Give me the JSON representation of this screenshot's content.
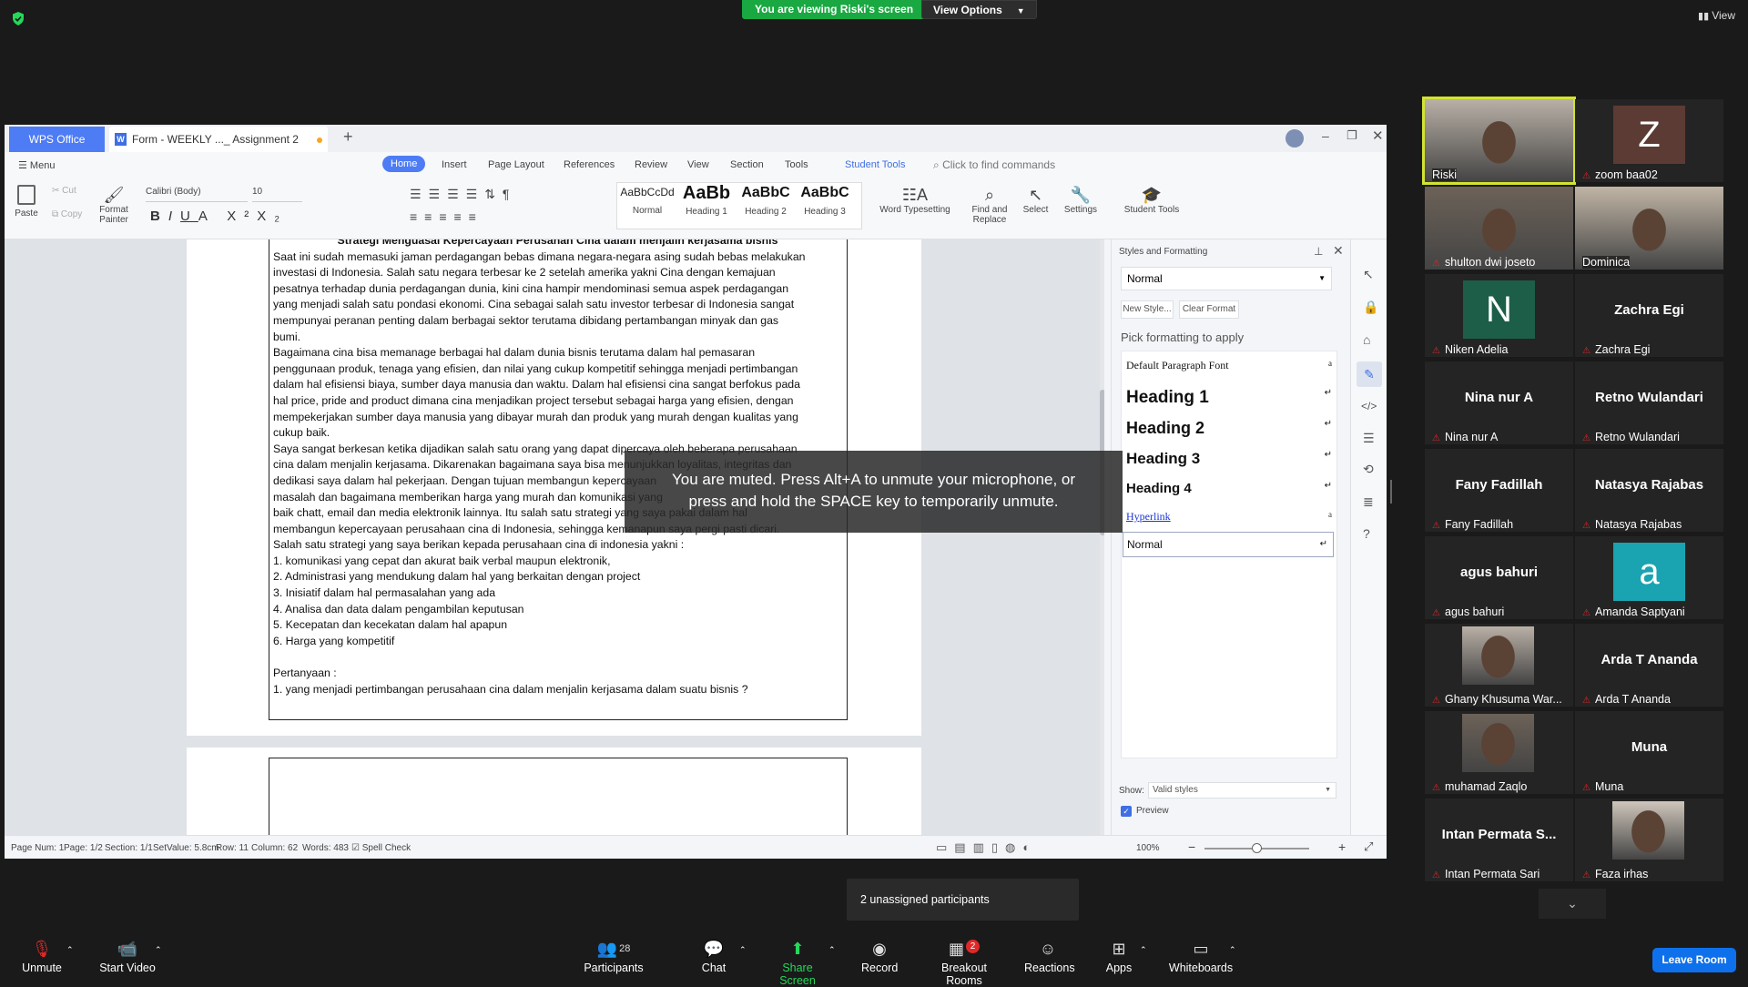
{
  "top": {
    "banner": "You are viewing Riski's screen",
    "view_options": "View Options",
    "view": "View"
  },
  "wps": {
    "app_tab": "WPS Office",
    "doc_tab": "Form - WEEKLY ..._ Assignment 2",
    "ribbon_tabs": [
      "Menu",
      "Home",
      "Insert",
      "Page Layout",
      "References",
      "Review",
      "View",
      "Section",
      "Tools",
      "Student Tools"
    ],
    "search_placeholder": "Click to find commands",
    "ribbon": {
      "paste": "Paste",
      "cut": "Cut",
      "copy": "Copy",
      "format_painter": "Format Painter",
      "font": "Calibri (Body)",
      "size": "10",
      "style_normal": "Normal",
      "style_h1": "Heading 1",
      "style_h2": "Heading 2",
      "style_h3": "Heading 3",
      "style_normal_sample": "AaBbCcDd",
      "style_h1_sample": "AaBb",
      "style_h2_sample": "AaBbC",
      "style_h3_sample": "AaBbC",
      "word_typesetting": "Word Typesetting",
      "find_replace": "Find and Replace",
      "select": "Select",
      "settings": "Settings",
      "student_tools": "Student Tools"
    },
    "doc_lines": [
      "Strategi Menguasai Kepercayaan Perusahan Cina dalam menjalin kerjasama bisnis",
      "Saat ini sudah memasuki jaman perdagangan bebas dimana negara-negara asing sudah bebas melakukan",
      "investasi di Indonesia. Salah satu negara terbesar ke 2 setelah amerika yakni Cina dengan kemajuan",
      "pesatnya terhadap dunia perdagangan dunia, kini cina hampir mendominasi semua aspek perdagangan",
      "yang menjadi salah satu pondasi ekonomi. Cina sebagai salah satu investor terbesar di Indonesia sangat",
      "mempunyai peranan penting dalam berbagai sektor terutama dibidang pertambangan minyak dan gas",
      "bumi.",
      "Bagaimana cina bisa memanage berbagai hal dalam dunia bisnis terutama dalam hal pemasaran",
      "penggunaan produk, tenaga yang efisien, dan nilai yang cukup kompetitif sehingga menjadi pertimbangan",
      "dalam hal efisiensi biaya, sumber daya manusia dan waktu. Dalam hal efisiensi cina sangat berfokus pada",
      "hal price, pride and  product dimana cina menjadikan project tersebut sebagai harga yang efisien, dengan",
      "mempekerjakan sumber daya manusia yang dibayar murah dan produk yang murah dengan kualitas yang",
      "cukup baik.",
      "Saya sangat berkesan ketika dijadikan salah satu orang yang dapat dipercaya oleh beberapa perusahaan",
      "cina dalam menjalin kerjasama. Dikarenakan bagaimana saya bisa menunjukkan loyalitas, integritas dan",
      "dedikasi saya dalam hal pekerjaan. Dengan tujuan membangun kepercayaan",
      "masalah dan bagaimana memberikan harga yang murah dan komunikasi yang",
      "baik chatt, email dan media elektronik lainnya. Itu salah satu strategi yang saya pakai dalam hal",
      "membangun kepercayaan perusahaan cina di Indonesia, sehingga kemanapun saya pergi pasti dicari.",
      "Salah satu strategi yang saya berikan kepada perusahaan cina di indonesia yakni :",
      "1. komunikasi yang cepat dan akurat baik verbal maupun elektronik,",
      "2. Administrasi yang mendukung dalam hal yang berkaitan dengan project",
      "3. Inisiatif dalam hal permasalahan yang ada",
      "4. Analisa dan data dalam pengambilan keputusan",
      "5. Kecepatan dan kecekatan dalam hal apapun",
      "6. Harga yang kompetitif",
      "",
      "Pertanyaan :",
      "1.  yang menjadi pertimbangan perusahaan cina dalam menjalin kerjasama dalam suatu bisnis ?"
    ],
    "styles_pane": {
      "title": "Styles and Formatting",
      "current": "Normal",
      "new_style": "New Style...",
      "clear_format": "Clear Format",
      "pick": "Pick formatting to apply",
      "items": [
        "Default Paragraph Font",
        "Heading 1",
        "Heading 2",
        "Heading 3",
        "Heading 4",
        "Hyperlink",
        "Normal"
      ],
      "show_label": "Show:",
      "show_value": "Valid styles",
      "preview": "Preview"
    },
    "status": {
      "page_num": "Page Num: 1",
      "page": "Page: 1/2",
      "section": "Section: 1/1",
      "setvalue": "SetValue: 5.8cm",
      "row": "Row: 11",
      "column": "Column: 62",
      "words": "Words: 483",
      "spell": "Spell Check",
      "zoom": "100%",
      "zoom_level": 0.5
    }
  },
  "muted_msg_1": "You are muted. Press Alt+A to unmute your microphone, or",
  "muted_msg_2": "press and hold the SPACE key to temporarily unmute.",
  "participants": [
    {
      "name": "Riski",
      "type": "photo"
    },
    {
      "name": "zoom baa02",
      "type": "letter",
      "letter": "Z",
      "color": "#5b3b33"
    },
    {
      "name": "shulton dwi joseto",
      "type": "photo"
    },
    {
      "name": "Dominica",
      "type": "photo"
    },
    {
      "name": "Niken Adelia",
      "type": "letter",
      "letter": "N",
      "color": "#1d5e49"
    },
    {
      "name": "Zachra Egi",
      "type": "text"
    },
    {
      "name": "Nina nur A",
      "type": "text"
    },
    {
      "name": "Retno Wulandari",
      "type": "text"
    },
    {
      "name": "Fany Fadillah",
      "type": "text"
    },
    {
      "name": "Natasya Rajabas",
      "type": "text"
    },
    {
      "name": "agus bahuri",
      "type": "text"
    },
    {
      "name": "Amanda Saptyani",
      "type": "letter",
      "letter": "a",
      "color": "#1aa3b0"
    },
    {
      "name": "Ghany Khusuma War...",
      "type": "photo"
    },
    {
      "name": "Arda T Ananda",
      "type": "text"
    },
    {
      "name": "muhamad Zaqlo",
      "type": "photo"
    },
    {
      "name": "Muna",
      "type": "text"
    },
    {
      "name": "Intan Permata Sari",
      "type": "text",
      "big": "Intan Permata S..."
    },
    {
      "name": "Faza irhas",
      "type": "photo"
    }
  ],
  "unassigned": "2 unassigned participants",
  "toolbar": {
    "unmute": "Unmute",
    "start_video": "Start Video",
    "participants": "Participants",
    "participants_count": "28",
    "chat": "Chat",
    "share_screen": "Share Screen",
    "record": "Record",
    "breakout_rooms": "Breakout Rooms",
    "breakout_badge": "2",
    "reactions": "Reactions",
    "apps": "Apps",
    "whiteboards": "Whiteboards",
    "leave_room": "Leave Room"
  }
}
